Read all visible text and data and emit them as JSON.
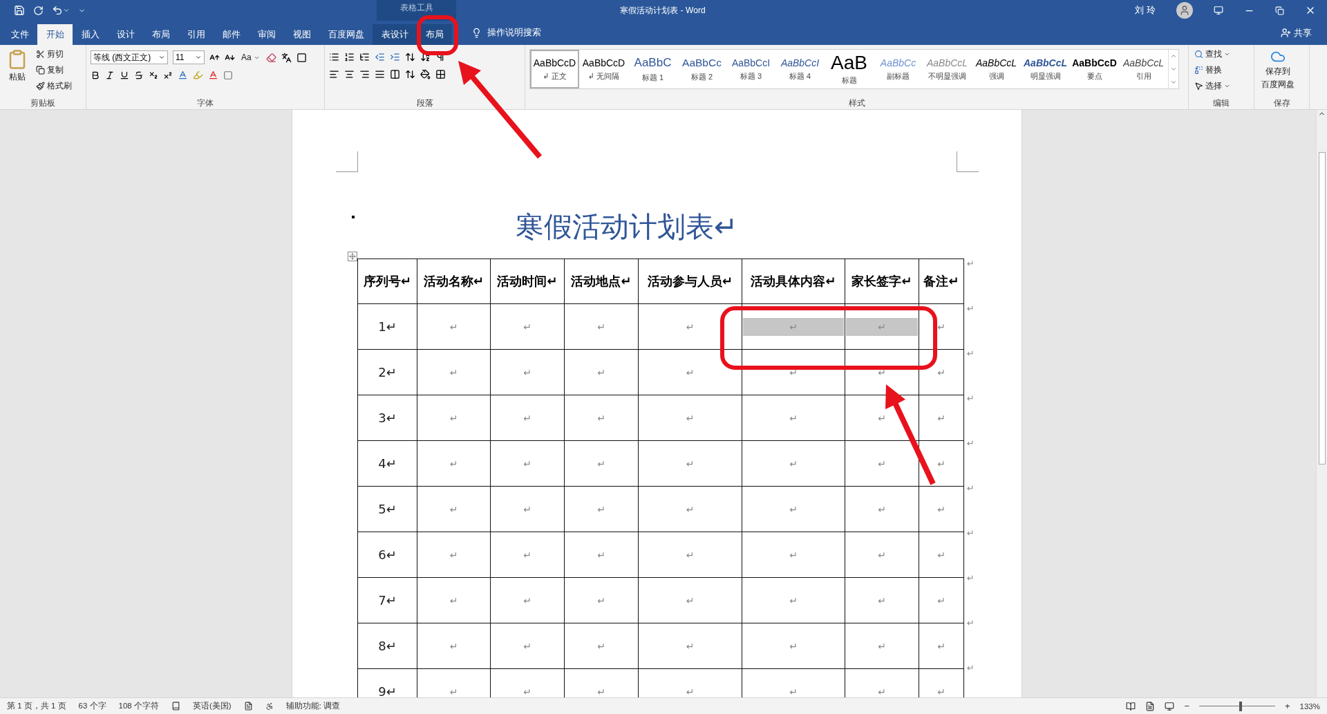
{
  "title": "寒假活动计划表  -  Word",
  "contextual_group": "表格工具",
  "user": "刘 玲",
  "tabs": [
    {
      "label": "文件",
      "selected": false,
      "contextual": false
    },
    {
      "label": "开始",
      "selected": true,
      "contextual": false
    },
    {
      "label": "插入",
      "selected": false,
      "contextual": false
    },
    {
      "label": "设计",
      "selected": false,
      "contextual": false
    },
    {
      "label": "布局",
      "selected": false,
      "contextual": false
    },
    {
      "label": "引用",
      "selected": false,
      "contextual": false
    },
    {
      "label": "邮件",
      "selected": false,
      "contextual": false
    },
    {
      "label": "审阅",
      "selected": false,
      "contextual": false
    },
    {
      "label": "视图",
      "selected": false,
      "contextual": false
    },
    {
      "label": "百度网盘",
      "selected": false,
      "contextual": false
    },
    {
      "label": "表设计",
      "selected": false,
      "contextual": true
    },
    {
      "label": "布局",
      "selected": false,
      "contextual": true
    }
  ],
  "tell_me": "操作说明搜索",
  "share": "共享",
  "ribbon": {
    "clipboard": {
      "label": "剪贴板",
      "paste": "粘贴",
      "cut": "剪切",
      "copy": "复制",
      "format_painter": "格式刷"
    },
    "font": {
      "label": "字体",
      "font_name": "等线 (西文正文)",
      "font_size": "11",
      "case_button": "Aa"
    },
    "paragraph": {
      "label": "段落"
    },
    "styles": {
      "label": "样式",
      "items": [
        {
          "preview": "AaBbCcD",
          "name": "↲ 正文",
          "kind": "normal",
          "selected": true
        },
        {
          "preview": "AaBbCcD",
          "name": "↲ 无间隔",
          "kind": "normal",
          "selected": false
        },
        {
          "preview": "AaBbC",
          "name": "标题 1",
          "kind": "heading1",
          "selected": false
        },
        {
          "preview": "AaBbCc",
          "name": "标题 2",
          "kind": "heading2",
          "selected": false
        },
        {
          "preview": "AaBbCcI",
          "name": "标题 3",
          "kind": "heading3",
          "selected": false
        },
        {
          "preview": "AaBbCcI",
          "name": "标题 4",
          "kind": "heading4",
          "selected": false
        },
        {
          "preview": "AaB",
          "name": "标题",
          "kind": "title",
          "selected": false
        },
        {
          "preview": "AaBbCc",
          "name": "副标题",
          "kind": "subtitle",
          "selected": false
        },
        {
          "preview": "AaBbCcL",
          "name": "不明显强调",
          "kind": "subtle",
          "selected": false
        },
        {
          "preview": "AaBbCcL",
          "name": "强调",
          "kind": "emphasis",
          "selected": false
        },
        {
          "preview": "AaBbCcL",
          "name": "明显强调",
          "kind": "intense",
          "selected": false
        },
        {
          "preview": "AaBbCcD",
          "name": "要点",
          "kind": "strong",
          "selected": false
        },
        {
          "preview": "AaBbCcL",
          "name": "引用",
          "kind": "quote",
          "selected": false
        }
      ]
    },
    "editing": {
      "label": "编辑",
      "find": "查找",
      "replace": "替换",
      "select": "选择"
    },
    "save": {
      "label": "保存",
      "button": [
        "保存到",
        "百度网盘"
      ]
    }
  },
  "document": {
    "title": "寒假活动计划表↵",
    "table": {
      "header": [
        "序列号↵",
        "活动名称↵",
        "活动时间↵",
        "活动地点↵",
        "活动参与人员↵",
        "活动具体内容↵",
        "家长签字↵",
        "备注↵"
      ],
      "header_end": "↵",
      "rows": [
        {
          "cells": [
            {
              "text": "1↵",
              "selected": false
            },
            {
              "text": "↵",
              "selected": false
            },
            {
              "text": "↵",
              "selected": false
            },
            {
              "text": "↵",
              "selected": false
            },
            {
              "text": "↵",
              "selected": false
            },
            {
              "text": "↵",
              "selected": true
            },
            {
              "text": "↵",
              "selected": true
            },
            {
              "text": "↵",
              "selected": false
            }
          ],
          "end": "↵"
        },
        {
          "cells": [
            {
              "text": "2↵",
              "selected": false
            },
            {
              "text": "↵",
              "selected": false
            },
            {
              "text": "↵",
              "selected": false
            },
            {
              "text": "↵",
              "selected": false
            },
            {
              "text": "↵",
              "selected": false
            },
            {
              "text": "↵",
              "selected": false
            },
            {
              "text": "↵",
              "selected": false
            },
            {
              "text": "↵",
              "selected": false
            }
          ],
          "end": "↵"
        },
        {
          "cells": [
            {
              "text": "3↵",
              "selected": false
            },
            {
              "text": "↵",
              "selected": false
            },
            {
              "text": "↵",
              "selected": false
            },
            {
              "text": "↵",
              "selected": false
            },
            {
              "text": "↵",
              "selected": false
            },
            {
              "text": "↵",
              "selected": false
            },
            {
              "text": "↵",
              "selected": false
            },
            {
              "text": "↵",
              "selected": false
            }
          ],
          "end": "↵"
        },
        {
          "cells": [
            {
              "text": "4↵",
              "selected": false
            },
            {
              "text": "↵",
              "selected": false
            },
            {
              "text": "↵",
              "selected": false
            },
            {
              "text": "↵",
              "selected": false
            },
            {
              "text": "↵",
              "selected": false
            },
            {
              "text": "↵",
              "selected": false
            },
            {
              "text": "↵",
              "selected": false
            },
            {
              "text": "↵",
              "selected": false
            }
          ],
          "end": "↵"
        },
        {
          "cells": [
            {
              "text": "5↵",
              "selected": false
            },
            {
              "text": "↵",
              "selected": false
            },
            {
              "text": "↵",
              "selected": false
            },
            {
              "text": "↵",
              "selected": false
            },
            {
              "text": "↵",
              "selected": false
            },
            {
              "text": "↵",
              "selected": false
            },
            {
              "text": "↵",
              "selected": false
            },
            {
              "text": "↵",
              "selected": false
            }
          ],
          "end": "↵"
        },
        {
          "cells": [
            {
              "text": "6↵",
              "selected": false
            },
            {
              "text": "↵",
              "selected": false
            },
            {
              "text": "↵",
              "selected": false
            },
            {
              "text": "↵",
              "selected": false
            },
            {
              "text": "↵",
              "selected": false
            },
            {
              "text": "↵",
              "selected": false
            },
            {
              "text": "↵",
              "selected": false
            },
            {
              "text": "↵",
              "selected": false
            }
          ],
          "end": "↵"
        },
        {
          "cells": [
            {
              "text": "7↵",
              "selected": false
            },
            {
              "text": "↵",
              "selected": false
            },
            {
              "text": "↵",
              "selected": false
            },
            {
              "text": "↵",
              "selected": false
            },
            {
              "text": "↵",
              "selected": false
            },
            {
              "text": "↵",
              "selected": false
            },
            {
              "text": "↵",
              "selected": false
            },
            {
              "text": "↵",
              "selected": false
            }
          ],
          "end": "↵"
        },
        {
          "cells": [
            {
              "text": "8↵",
              "selected": false
            },
            {
              "text": "↵",
              "selected": false
            },
            {
              "text": "↵",
              "selected": false
            },
            {
              "text": "↵",
              "selected": false
            },
            {
              "text": "↵",
              "selected": false
            },
            {
              "text": "↵",
              "selected": false
            },
            {
              "text": "↵",
              "selected": false
            },
            {
              "text": "↵",
              "selected": false
            }
          ],
          "end": "↵"
        },
        {
          "cells": [
            {
              "text": "9↵",
              "selected": false
            },
            {
              "text": "↵",
              "selected": false
            },
            {
              "text": "↵",
              "selected": false
            },
            {
              "text": "↵",
              "selected": false
            },
            {
              "text": "↵",
              "selected": false
            },
            {
              "text": "↵",
              "selected": false
            },
            {
              "text": "↵",
              "selected": false
            },
            {
              "text": "↵",
              "selected": false
            }
          ],
          "end": "↵"
        }
      ]
    }
  },
  "status_bar": {
    "page": "第 1 页，共 1 页",
    "words": "63 个字",
    "chars": "108 个字符",
    "language": "英语(美国)",
    "accessibility": "辅助功能: 调查",
    "zoom_out": "−",
    "zoom_in": "+",
    "zoom": {
      "level": 0.55
    },
    "zoom_percent": "133%"
  }
}
